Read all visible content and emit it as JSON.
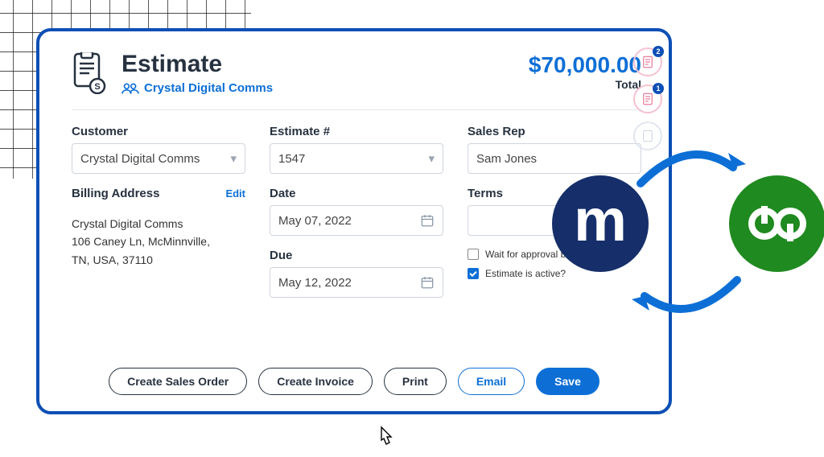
{
  "header": {
    "title": "Estimate",
    "customer_link": "Crystal Digital Comms",
    "amount": "$70,000.00",
    "amount_label": "Total"
  },
  "mini_badges": [
    {
      "count": "2"
    },
    {
      "count": "1"
    }
  ],
  "fields": {
    "customer_label": "Customer",
    "customer_value": "Crystal Digital Comms",
    "billing_label": "Billing Address",
    "billing_edit": "Edit",
    "billing_address_line1": "Crystal Digital Comms",
    "billing_address_line2": "106 Caney Ln, McMinnville,",
    "billing_address_line3": "TN, USA, 37110",
    "estimate_no_label": "Estimate #",
    "estimate_no_value": "1547",
    "date_label": "Date",
    "date_value": "May 07, 2022",
    "due_label": "Due",
    "due_value": "May 12, 2022",
    "rep_label": "Sales Rep",
    "rep_value": "Sam Jones",
    "terms_label": "Terms",
    "terms_value": "",
    "cb_wait": "Wait for approval before syncing",
    "cb_active": "Estimate is active?"
  },
  "footer": {
    "create_order": "Create Sales Order",
    "create_invoice": "Create Invoice",
    "print": "Print",
    "email": "Email",
    "save": "Save"
  }
}
